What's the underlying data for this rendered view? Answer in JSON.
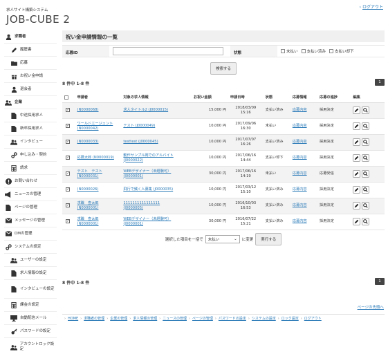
{
  "header": {
    "subtitle": "求人サイト構築システム",
    "logo": "JOB-CUBE 2",
    "logout": "ログアウト"
  },
  "sidebar": {
    "items": [
      {
        "label": "求職者",
        "icon": "user-icon",
        "type": "sec"
      },
      {
        "label": "履歴書",
        "icon": "pen-icon",
        "type": "sub"
      },
      {
        "label": "応募",
        "icon": "folder-icon",
        "type": "sub"
      },
      {
        "label": "お祝い金申請",
        "icon": "gift-icon",
        "type": "sub"
      },
      {
        "label": "退会者",
        "icon": "user-icon",
        "type": "sub"
      },
      {
        "label": "企業",
        "icon": "users-icon",
        "type": "sec"
      },
      {
        "label": "中途採用求人",
        "icon": "doc-icon",
        "type": "sub"
      },
      {
        "label": "新卒採用求人",
        "icon": "doc-icon",
        "type": "sub"
      },
      {
        "label": "インタビュー",
        "icon": "users-icon",
        "type": "sub"
      },
      {
        "label": "申し込み・契約",
        "icon": "link-icon",
        "type": "sub"
      },
      {
        "label": "請求",
        "icon": "calc-icon",
        "type": "sub"
      },
      {
        "label": "お問い合わせ",
        "icon": "info-icon",
        "type": "top"
      },
      {
        "label": "ニュースの管理",
        "icon": "megaphone-icon",
        "type": "top"
      },
      {
        "label": "ページの管理",
        "icon": "doc-icon",
        "type": "top"
      },
      {
        "label": "メッセージの管理",
        "icon": "mail-icon",
        "type": "top"
      },
      {
        "label": "DMの管理",
        "icon": "mail-icon",
        "type": "top"
      },
      {
        "label": "システムの設定",
        "icon": "link-icon",
        "type": "top"
      },
      {
        "label": "ユーザーの設定",
        "icon": "users-icon",
        "type": "sub"
      },
      {
        "label": "求人情報の設定",
        "icon": "doc-icon",
        "type": "sub"
      },
      {
        "label": "インタビューの設定",
        "icon": "doc-icon",
        "type": "sub-tall"
      },
      {
        "label": "課金の設定",
        "icon": "calc-icon",
        "type": "sub"
      },
      {
        "label": "自動配信メール",
        "icon": "monitor-icon",
        "type": "sub"
      },
      {
        "label": "パスワードの設定",
        "icon": "key-icon",
        "type": "sub"
      },
      {
        "label": "アカウントロック設定",
        "icon": "users-icon",
        "type": "sub-tall"
      }
    ]
  },
  "main": {
    "title": "祝い金申請情報の一覧",
    "search": {
      "app_id_label": "応募ID",
      "app_id_value": "",
      "status_label": "状態",
      "status_options": [
        {
          "label": "未払い",
          "checked": false
        },
        {
          "label": "支払い済み",
          "checked": false
        },
        {
          "label": "支払い却下",
          "checked": false
        }
      ],
      "search_button": "検索する"
    },
    "count": "8 件中 1-8 件",
    "page": "1",
    "columns": [
      "申請者",
      "対象の求人情報",
      "お祝い金額",
      "申請日時",
      "状態",
      "応募情報",
      "応募の進捗",
      "編集"
    ],
    "rows": [
      {
        "applicant": "(N0000068)",
        "job": "求人タイトル2 (J0000015)",
        "amount": "15,000 円",
        "date": "2018/03/09",
        "time": "15:16",
        "status": "支払い済み",
        "info": "応募内容",
        "progress": "採用決定"
      },
      {
        "applicant": "ワールドエージェント",
        "applicant2": "(N0000042)",
        "job": "テスト (J0000049)",
        "amount": "10,000 円",
        "date": "2017/09/06",
        "time": "16:30",
        "status": "未払い",
        "info": "応募内容",
        "progress": "採用決定"
      },
      {
        "applicant": "(N0000033)",
        "job": "testtest (J0000045)",
        "amount": "10,000 円",
        "date": "2017/07/07",
        "time": "16:26",
        "status": "支払い済み",
        "info": "応募内容",
        "progress": "採用決定"
      },
      {
        "applicant": "応募太郎 (N0000019)",
        "job": "動作サンプル岡でのアルバイト",
        "job2": "(J0000022)",
        "amount": "10,000 円",
        "date": "2017/06/16",
        "time": "14:44",
        "status": "支払い却下",
        "info": "応募内容",
        "progress": "採用決定"
      },
      {
        "applicant": "テスト　テスト",
        "applicant2": "(N0000031)",
        "job": "WEBデザイナー（未経験可）",
        "job2": "(J0000001)",
        "amount": "30,000 円",
        "date": "2017/06/16",
        "time": "14:19",
        "status": "未払い",
        "info": "応募内容",
        "progress": "応募受信"
      },
      {
        "applicant": "(N0000026)",
        "job": "飛行で銭く人募集 (J0000035)",
        "amount": "10,000 円",
        "date": "2017/03/12",
        "time": "15:10",
        "status": "支払い済み",
        "info": "応募内容",
        "progress": "採用決定"
      },
      {
        "applicant": "求職　查太郎",
        "applicant2": "(N0000001)",
        "job": "1111111111111111",
        "job2": "(J0000005)",
        "amount": "10,000 円",
        "date": "2016/10/03",
        "time": "16:53",
        "status": "支払い済み",
        "info": "応募内容",
        "progress": "採用決定"
      },
      {
        "applicant": "求職　查太郎",
        "applicant2": "(N0000001)",
        "job": "WEBデザイナー（未経験可）",
        "job2": "(J0000001)",
        "amount": "30,000 円",
        "date": "2016/07/22",
        "time": "15:21",
        "status": "支払い済み",
        "info": "応募内容",
        "progress": "採用決定"
      }
    ],
    "bulk": {
      "label": "選択した項目を一括で",
      "select_value": "未払い",
      "suffix": "に変更",
      "exec_button": "実行する"
    }
  },
  "footer": {
    "pagetop": "ページの先頭へ",
    "nav": [
      "HOME",
      "求職者の管理",
      "企業の管理",
      "求人情報の管理",
      "ニュースの管理",
      "ページの管理",
      "パスワードの設定",
      "システムの設定",
      "ロック設定",
      "ログアウト"
    ]
  }
}
